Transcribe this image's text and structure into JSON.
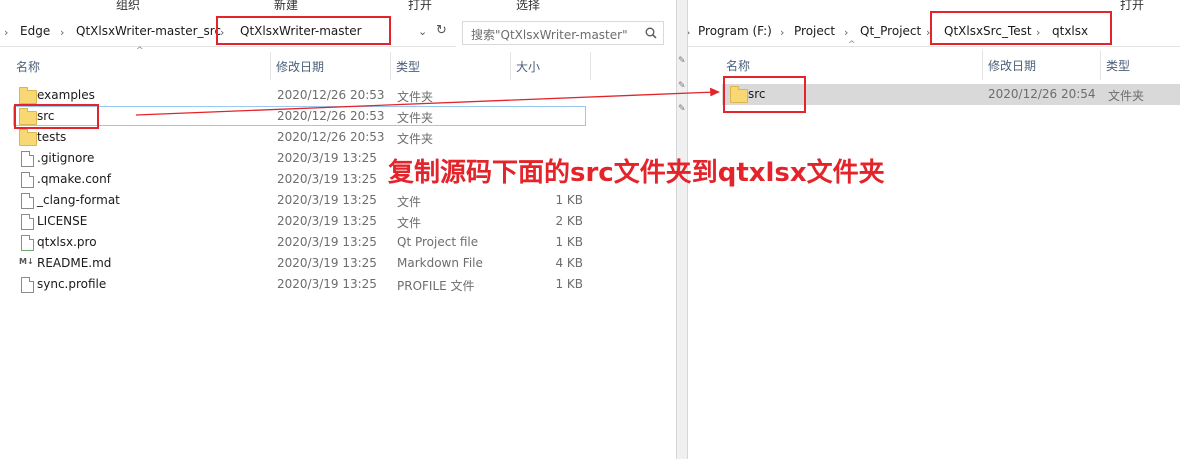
{
  "ribbon": {
    "organize": "组织",
    "new": "新建",
    "open": "打开",
    "select": "选择",
    "open_right": "打开"
  },
  "left_pane": {
    "breadcrumb": [
      "Edge",
      "QtXlsxWriter-master_src",
      "QtXlsxWriter-master"
    ],
    "search_placeholder": "搜索\"QtXlsxWriter-master\"",
    "columns": {
      "name": "名称",
      "modified": "修改日期",
      "type": "类型",
      "size": "大小"
    },
    "rows": [
      {
        "name": "examples",
        "modified": "2020/12/26 20:53",
        "type": "文件夹",
        "size": "",
        "icon": "folder-icon"
      },
      {
        "name": "src",
        "modified": "2020/12/26 20:53",
        "type": "文件夹",
        "size": "",
        "icon": "folder-icon"
      },
      {
        "name": "tests",
        "modified": "2020/12/26 20:53",
        "type": "文件夹",
        "size": "",
        "icon": "folder-icon"
      },
      {
        "name": ".gitignore",
        "modified": "2020/3/19 13:25",
        "type": "",
        "size": "",
        "icon": "file-icon"
      },
      {
        "name": ".qmake.conf",
        "modified": "2020/3/19 13:25",
        "type": "",
        "size": "",
        "icon": "file-icon"
      },
      {
        "name": "_clang-format",
        "modified": "2020/3/19 13:25",
        "type": "文件",
        "size": "1 KB",
        "icon": "file-icon"
      },
      {
        "name": "LICENSE",
        "modified": "2020/3/19 13:25",
        "type": "文件",
        "size": "2 KB",
        "icon": "file-icon"
      },
      {
        "name": "qtxlsx.pro",
        "modified": "2020/3/19 13:25",
        "type": "Qt Project file",
        "size": "1 KB",
        "icon": "pro-file-icon"
      },
      {
        "name": "README.md",
        "modified": "2020/3/19 13:25",
        "type": "Markdown File",
        "size": "4 KB",
        "icon": "md-file-icon"
      },
      {
        "name": "sync.profile",
        "modified": "2020/3/19 13:25",
        "type": "PROFILE 文件",
        "size": "1 KB",
        "icon": "file-icon"
      }
    ]
  },
  "right_pane": {
    "breadcrumb": [
      "Program (F:)",
      "Project",
      "Qt_Project",
      "QtXlsxSrc_Test",
      "qtxlsx"
    ],
    "columns": {
      "name": "名称",
      "modified": "修改日期",
      "type": "类型"
    },
    "rows": [
      {
        "name": "src",
        "modified": "2020/12/26 20:54",
        "type": "文件夹",
        "icon": "folder-icon"
      }
    ]
  },
  "annotation": {
    "text": "复制源码下面的src文件夹到qtxlsx文件夹",
    "color": "#e3242b"
  }
}
